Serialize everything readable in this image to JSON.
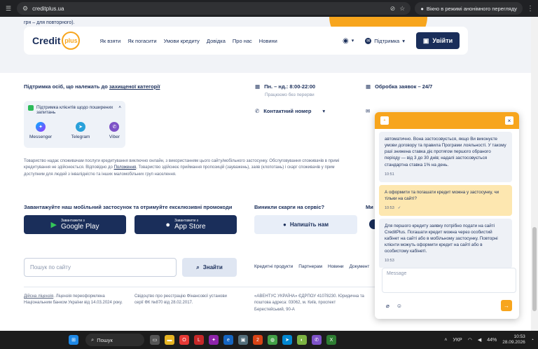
{
  "browser": {
    "url": "creditplus.ua",
    "incognito_label": "Вікно в режимі анонімного перегляду"
  },
  "page": {
    "partial_top_text": "грн – для повторного).",
    "logo": {
      "text": "Credit",
      "mark": "plus"
    },
    "nav": {
      "links": [
        "Як взяти",
        "Як погасити",
        "Умови кредиту",
        "Довідка",
        "Про нас",
        "Новини"
      ],
      "support_label": "Підтримка",
      "login_label": "Увійти"
    },
    "protected": {
      "prefix": "Підтримка осіб, що належать до ",
      "link": "захищеної категорії"
    },
    "hours": {
      "label": "Пн. – нд.: 8:00-22:00",
      "sub": "Працюємо без перерви"
    },
    "contact_label": "Контактний номер",
    "processing_label": "Обробка заявок – 24/7",
    "support_card": {
      "title": "Підтримка клієнтів щодо поширених запитань",
      "messengers": [
        "Messenger",
        "Telegram",
        "Viber"
      ]
    },
    "notice": {
      "line1": "Товариство надає споживачам послуги кредитування виключно онлайн, з використанням цього сайту/мобільного застосунку. Обслуговування споживачів в примі",
      "line2_prefix": "кредитування не здійснюється. Відповідно до ",
      "line2_link": "Положення",
      "line2_suffix": ", Товариство здійснює приймання пропозицій (зауважень), заяв (клопотань) і скарг споживачів у прим",
      "line3": "доступним для людей з інвалідністю та інших маломобільних груп населення."
    },
    "apps": {
      "title": "Завантажуйте наш мобільний застосунок та отримуйте ексклюзивні промокоди",
      "google_small": "Завантажити з",
      "google_big": "Google Play",
      "apple_small": "Завантажити з",
      "apple_big": "App Store"
    },
    "complaints": {
      "title": "Виникли скарги на сервіс?",
      "button": "Напишіть нам"
    },
    "cut_title": "Ми",
    "search": {
      "placeholder": "Пошук по сайту",
      "button": "Знайти"
    },
    "footer_links": [
      "Кредитні продукти",
      "Партнерам",
      "Новини",
      "Документ"
    ],
    "footer": {
      "license_link": "Дійсна ліцензія",
      "license_text": ". Ліцензія переоформлена Національним банком України від 14.03.2024 року.",
      "cert": "Свідоцтво про реєстрацію Фінансової установи серії ФК №870 від 28.02.2017.",
      "company": "«АВЕНТУС УКРАЇНА» ЄДРПОУ 41078230. Юридична та поштова адреса: 03062, м. Київ, проспект Берестейський, 90-А"
    }
  },
  "chat": {
    "messages": [
      {
        "from": "bot",
        "text": "автоматично. Вона застосовується, якщо Ви виконуєте умови договору та правила Програми лояльності. У такому разі знижена ставка діє протягом першого обраного періоду — від 3 до 30 днів; надалі застосовується стандартна ставка 1% на день.",
        "time": "10:51"
      },
      {
        "from": "user",
        "text": "А оформити та погашати кредит можна у застосунку, чи тільки на сайті?",
        "time": "10:53"
      },
      {
        "from": "bot",
        "text": "Для першого кредиту заявку потрібно подати на сайті CreditPlus. Погашати кредит можна через особистий кабінет на сайті або в мобільному застосунку. Повторні клієнти можуть оформити кредит на сайті або в особистому кабінеті.",
        "time": "10:53"
      }
    ],
    "input_placeholder": "Message"
  },
  "taskbar": {
    "search_label": "Пошук",
    "lang": "УКР",
    "battery": "44%",
    "time": "10:53",
    "date": "28.09.2026"
  },
  "colors": {
    "brand_navy": "#1a2e5a",
    "brand_orange": "#f7a51d"
  }
}
